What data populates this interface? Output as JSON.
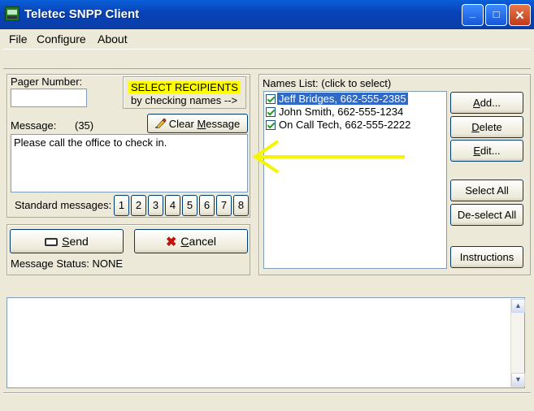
{
  "window": {
    "title": "Teletec SNPP Client",
    "min_glyph": "_",
    "max_glyph": "□",
    "close_glyph": "✕"
  },
  "menu": [
    "File",
    "Configure",
    "About"
  ],
  "pager": {
    "label": "Pager Number:",
    "value": ""
  },
  "hint": {
    "line1": "SELECT RECIPIENTS",
    "line2": "by checking names -->"
  },
  "message": {
    "label": "Message:",
    "count": "(35)",
    "clear_label_a": "Clear ",
    "clear_label_b": "M",
    "clear_label_c": "essage",
    "text": "Please call the office to check in."
  },
  "standard": {
    "label": "Standard messages:",
    "buttons": [
      "1",
      "2",
      "3",
      "4",
      "5",
      "6",
      "7",
      "8"
    ]
  },
  "send": {
    "label_u": "S",
    "label_rest": "end"
  },
  "cancel": {
    "label_u": "C",
    "label_rest": "ancel"
  },
  "status": {
    "text": "Message Status: NONE"
  },
  "names": {
    "label": "Names List:  (click to select)",
    "items": [
      {
        "label": "Jeff Bridges, 662-555-2385",
        "checked": true,
        "selected": true
      },
      {
        "label": "John Smith, 662-555-1234",
        "checked": true,
        "selected": false
      },
      {
        "label": "On Call Tech, 662-555-2222",
        "checked": true,
        "selected": false
      }
    ]
  },
  "side_buttons": {
    "add_u": "A",
    "add_rest": "dd...",
    "delete_u": "D",
    "delete_rest": "elete",
    "edit_u": "E",
    "edit_rest": "dit...",
    "select_all": "Select All",
    "deselect_all": "De-select All",
    "instructions": "Instructions"
  },
  "colors": {
    "arrow": "#f5f500",
    "hint_bg": "#ffff00",
    "selection": "#316ac5",
    "cancel_x": "#c0140c"
  },
  "log": {
    "text": ""
  }
}
